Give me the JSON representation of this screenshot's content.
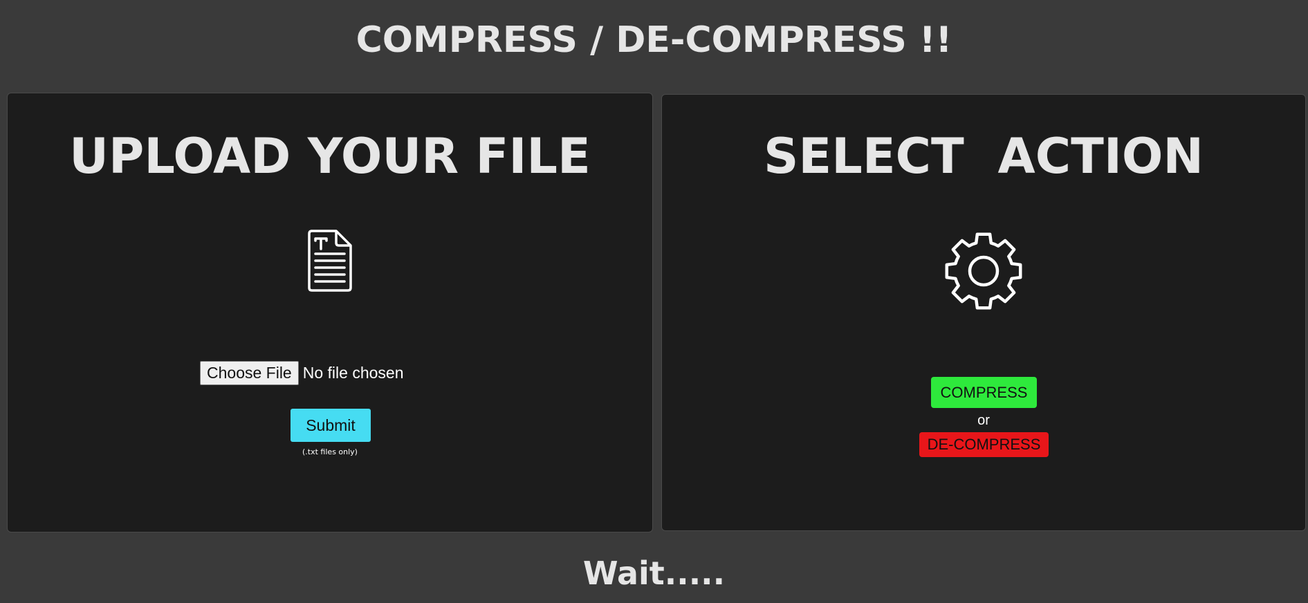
{
  "header": {
    "title": "COMPRESS / DE-COMPRESS !!"
  },
  "upload_panel": {
    "heading": "UPLOAD YOUR FILE",
    "icon": "text-file-icon",
    "file_input": {
      "button_label": "Choose File",
      "status_text": "No file chosen"
    },
    "submit_label": "Submit",
    "note": "(.txt files only)"
  },
  "action_panel": {
    "heading": "SELECT  ACTION",
    "icon": "gear-icon",
    "compress_label": "COMPRESS",
    "separator": "or",
    "decompress_label": "DE-COMPRESS",
    "colors": {
      "compress": "#2ee93c",
      "decompress": "#e8161a"
    }
  },
  "footer": {
    "status": "Wait....."
  },
  "colors": {
    "background": "#3a3a3a",
    "panel": "#1c1c1c",
    "submit": "#46dcf2"
  }
}
